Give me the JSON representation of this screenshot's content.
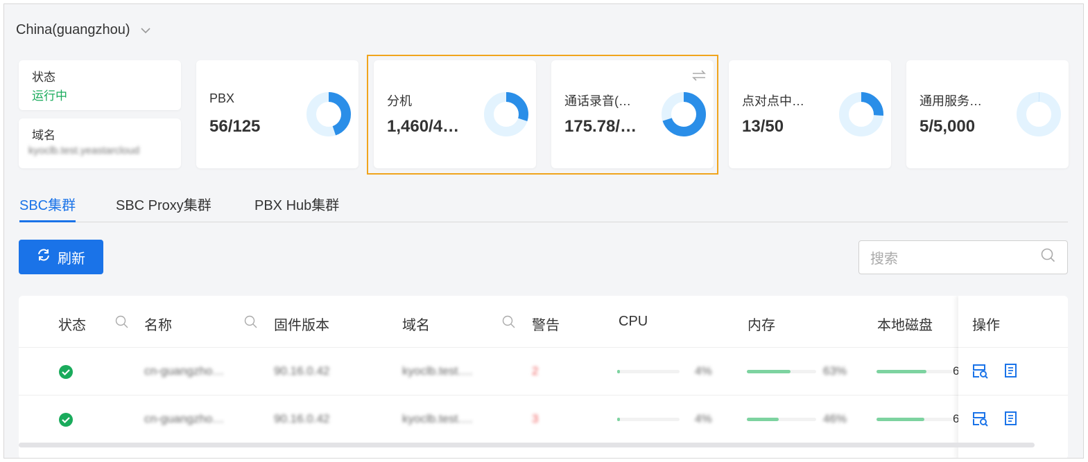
{
  "region": {
    "value": "China(guangzhou)"
  },
  "status_card": {
    "label": "状态",
    "value": "运行中",
    "domain_label": "域名",
    "domain_value": "kyoclb.test.yeastarcloud"
  },
  "stats": [
    {
      "label": "PBX",
      "value": "56/125",
      "fraction": 0.448
    },
    {
      "label": "分机",
      "value": "1,460/4…",
      "fraction": 0.3
    },
    {
      "label": "通话录音(…",
      "value": "175.78/…",
      "fraction": 0.7
    },
    {
      "label": "点对点中…",
      "value": "13/50",
      "fraction": 0.26
    },
    {
      "label": "通用服务…",
      "value": "5/5,000",
      "fraction": 0.001
    }
  ],
  "tabs": [
    {
      "label": "SBC集群"
    },
    {
      "label": "SBC Proxy集群"
    },
    {
      "label": "PBX Hub集群"
    }
  ],
  "toolbar": {
    "refresh_label": "刷新",
    "search_placeholder": "搜索"
  },
  "table": {
    "headers": [
      "状态",
      "名称",
      "固件版本",
      "域名",
      "警告",
      "CPU",
      "内存",
      "本地磁盘",
      "操作"
    ],
    "rows": [
      {
        "name": "cn-guangzho…",
        "firmware": "90.16.0.42",
        "domain": "kyoclb.test.…",
        "warnings": "2",
        "cpu": "4%",
        "cpu_pct": 4,
        "mem": "63%",
        "mem_pct": 63,
        "disk_pct": 65,
        "disk": "6"
      },
      {
        "name": "cn-guangzho…",
        "firmware": "90.16.0.42",
        "domain": "kyoclb.test.…",
        "warnings": "3",
        "cpu": "4%",
        "cpu_pct": 4,
        "mem": "46%",
        "mem_pct": 46,
        "disk_pct": 63,
        "disk": "6"
      }
    ]
  },
  "colors": {
    "accent": "#1a73e8",
    "success": "#1aab5c",
    "highlight": "#f0a41c",
    "donut_fill": "#2a8ee8",
    "donut_track": "#e3f3fe"
  }
}
